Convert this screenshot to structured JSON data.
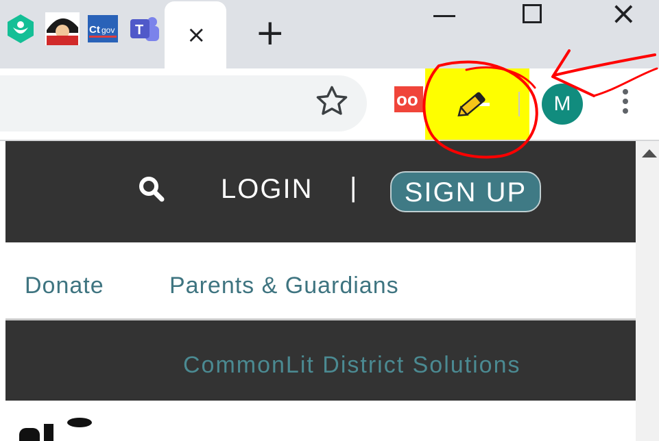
{
  "tabs": {
    "pinned": [
      {
        "name": "khan-academy-tab",
        "color": "#14bf96"
      },
      {
        "name": "comic-tab",
        "color": "#d12a2a"
      },
      {
        "name": "ct-gov-tab",
        "color": "#2962b8",
        "text": "Ct.gov"
      },
      {
        "name": "teams-tab",
        "color": "#5b5fc7",
        "text": "T"
      }
    ],
    "active_close": "×",
    "new_tab": "+"
  },
  "window_controls": {
    "minimize": "—",
    "maximize": "☐",
    "close": "×"
  },
  "toolbar": {
    "bookmark_icon": "star-icon",
    "extension_red_text": "oo",
    "highlighter_color": "#fefe00",
    "avatar_letter": "M",
    "avatar_color": "#118c7e"
  },
  "site": {
    "header": {
      "login": "LOGIN",
      "separator": "|",
      "signup": "SIGN UP"
    },
    "subnav": {
      "donate": "Donate",
      "parents": "Parents & Guardians"
    },
    "banner": {
      "link": "CommonLit District Solutions"
    }
  },
  "colors": {
    "header_bg": "#333333",
    "accent_teal": "#3e7480",
    "annotation_red": "#ff0000"
  }
}
